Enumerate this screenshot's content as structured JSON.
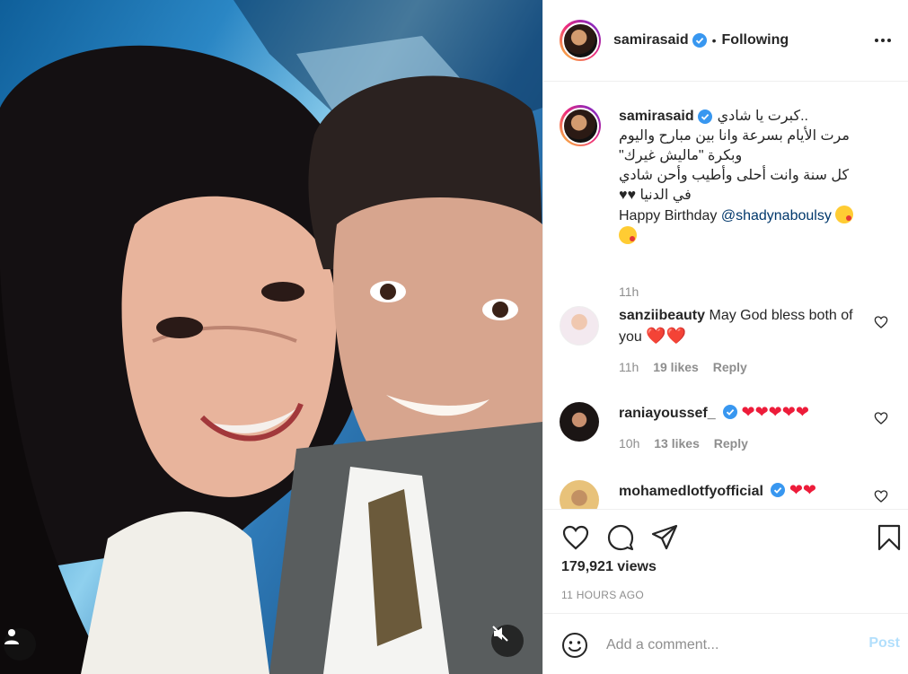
{
  "post": {
    "author": "samirasaid",
    "follow_status": "Following",
    "separator": "•"
  },
  "caption": {
    "username": "samirasaid",
    "lines": [
      "..كبرت يا شادي",
      "مرت الأيام بسرعة وانا بين مبارح واليوم",
      "وبكرة \"ماليش غيرك\"",
      "كل سنة وانت أحلى وأطيب وأحن شادي",
      "في الدنيا ♥♥"
    ],
    "birthday_text": "Happy Birthday",
    "mention": "@shadynaboulsy",
    "time": "11h"
  },
  "comments": [
    {
      "username": "sanziibeauty",
      "text": "May God bless both of you",
      "hearts": "❤️❤️",
      "time": "11h",
      "likes": "19 likes",
      "reply": "Reply"
    },
    {
      "username": "raniayoussef_",
      "text": "",
      "hearts": "❤❤❤❤❤",
      "time": "10h",
      "likes": "13 likes",
      "reply": "Reply"
    },
    {
      "username": "mohamedlotfyofficial",
      "text": "",
      "hearts": "❤❤",
      "time": "",
      "likes": "",
      "reply": ""
    }
  ],
  "stats": {
    "views": "179,921 views",
    "posted": "11 HOURS AGO"
  },
  "composer": {
    "placeholder": "Add a comment...",
    "post_label": "Post"
  },
  "colors": {
    "verified": "#3897f0",
    "link": "#00376b",
    "heart_red": "#ed1c3a",
    "post_disabled": "#b2dffc"
  }
}
